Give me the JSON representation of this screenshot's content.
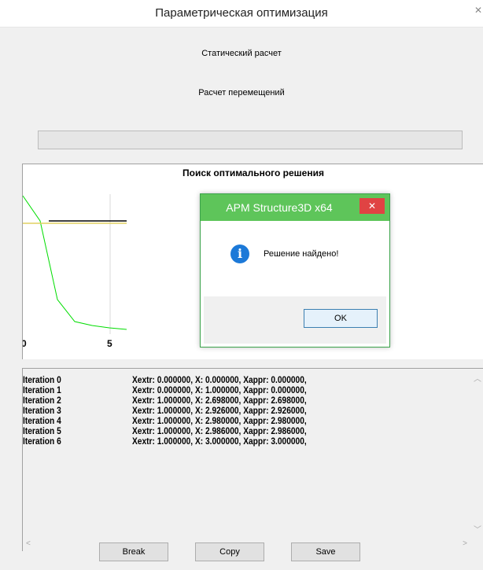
{
  "window": {
    "title": "Параметрическая оптимизация",
    "close_glyph": "✕"
  },
  "labels": {
    "static_calc": "Статический расчет",
    "displacement_calc": "Расчет перемещений"
  },
  "progress": {
    "fraction": 0
  },
  "chart": {
    "title": "Поиск оптимального решения",
    "tick_labels": [
      "0",
      "5"
    ]
  },
  "chart_data": {
    "type": "line",
    "title": "Поиск оптимального решения",
    "x": [
      0,
      1,
      2,
      3,
      4,
      5,
      6
    ],
    "xlabel": "",
    "ylabel": "",
    "xticks": [
      0,
      5
    ],
    "series": [
      {
        "color": "#000000",
        "values": [
          0.0,
          0.0,
          1.0,
          1.0,
          1.0,
          1.0,
          1.0
        ]
      },
      {
        "color": "#e0d060",
        "values": [
          0.0,
          0.0,
          2.698,
          2.926,
          2.98,
          2.986,
          3.0
        ]
      },
      {
        "color": "#00dd00",
        "values": [
          0.0,
          1.0,
          2.698,
          2.926,
          2.98,
          2.986,
          3.0
        ]
      }
    ]
  },
  "dialog": {
    "title": "APM Structure3D x64",
    "close_glyph": "✕",
    "message": "Решение найдено!",
    "ok_label": "OK",
    "icon": "info-icon"
  },
  "log": {
    "rows": [
      {
        "iter": "Iteration 0",
        "vals": "Xextr: 0.000000, X: 0.000000, Xappr: 0.000000,"
      },
      {
        "iter": "Iteration 1",
        "vals": "Xextr: 0.000000, X: 1.000000, Xappr: 0.000000,"
      },
      {
        "iter": "Iteration 2",
        "vals": "Xextr: 1.000000, X: 2.698000, Xappr: 2.698000,"
      },
      {
        "iter": "Iteration 3",
        "vals": "Xextr: 1.000000, X: 2.926000, Xappr: 2.926000,"
      },
      {
        "iter": "Iteration 4",
        "vals": "Xextr: 1.000000, X: 2.980000, Xappr: 2.980000,"
      },
      {
        "iter": "Iteration 5",
        "vals": "Xextr: 1.000000, X: 2.986000, Xappr: 2.986000,"
      },
      {
        "iter": "Iteration 6",
        "vals": "Xextr: 1.000000, X: 3.000000, Xappr: 3.000000,"
      }
    ]
  },
  "buttons": {
    "break": "Break",
    "copy": "Copy",
    "save": "Save"
  }
}
